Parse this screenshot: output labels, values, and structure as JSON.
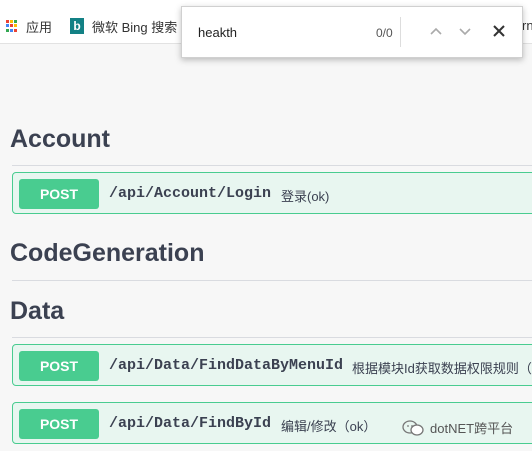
{
  "bookmarks": {
    "apps_label": "应用",
    "bing_label": "微软 Bing 搜索",
    "overflow_label": "rn"
  },
  "findbar": {
    "query": "heakth",
    "count": "0/0"
  },
  "sections": {
    "account": {
      "title": "Account",
      "ops": [
        {
          "method": "POST",
          "path": "/api/Account/Login",
          "summary": "登录(ok)"
        }
      ]
    },
    "codegen": {
      "title": "CodeGeneration"
    },
    "data": {
      "title": "Data",
      "ops": [
        {
          "method": "POST",
          "path": "/api/Data/FindDataByMenuId",
          "summary": "根据模块Id获取数据权限规则（"
        },
        {
          "method": "POST",
          "path": "/api/Data/FindById",
          "summary": "编辑/修改（ok）"
        }
      ]
    }
  },
  "watermark": {
    "text": "dotNET跨平台",
    "icon": "wechat-icon"
  },
  "colors": {
    "post_green": "#49cc90",
    "post_bg": "#e8f6f0",
    "text": "#3b4151"
  }
}
